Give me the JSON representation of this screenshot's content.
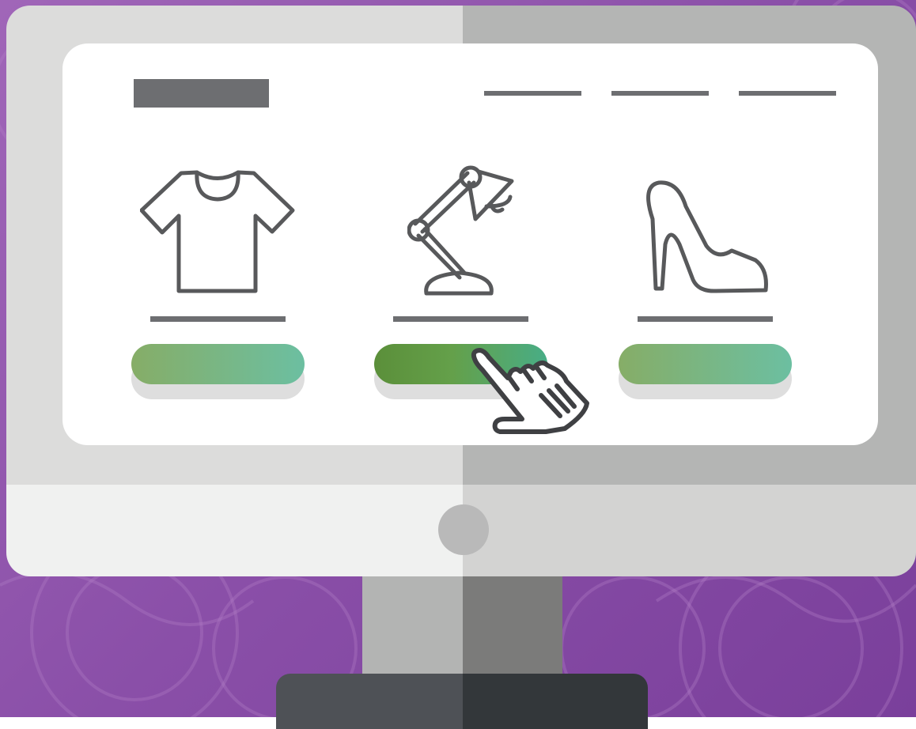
{
  "scene": {
    "background_color": "#8a4fa8",
    "accent_button_color": "#86ad67",
    "accent_button_end_color": "#6cbfa1",
    "ink_color": "#6d6e71"
  },
  "header": {
    "logo_icon": "logo-placeholder",
    "nav_links": [
      "nav-link-placeholder",
      "nav-link-placeholder",
      "nav-link-placeholder"
    ]
  },
  "products": [
    {
      "icon": "t-shirt-icon",
      "button_state": "default"
    },
    {
      "icon": "desk-lamp-icon",
      "button_state": "hovered"
    },
    {
      "icon": "high-heel-shoe-icon",
      "button_state": "default"
    }
  ],
  "pointer": {
    "icon": "hand-pointer-icon"
  }
}
